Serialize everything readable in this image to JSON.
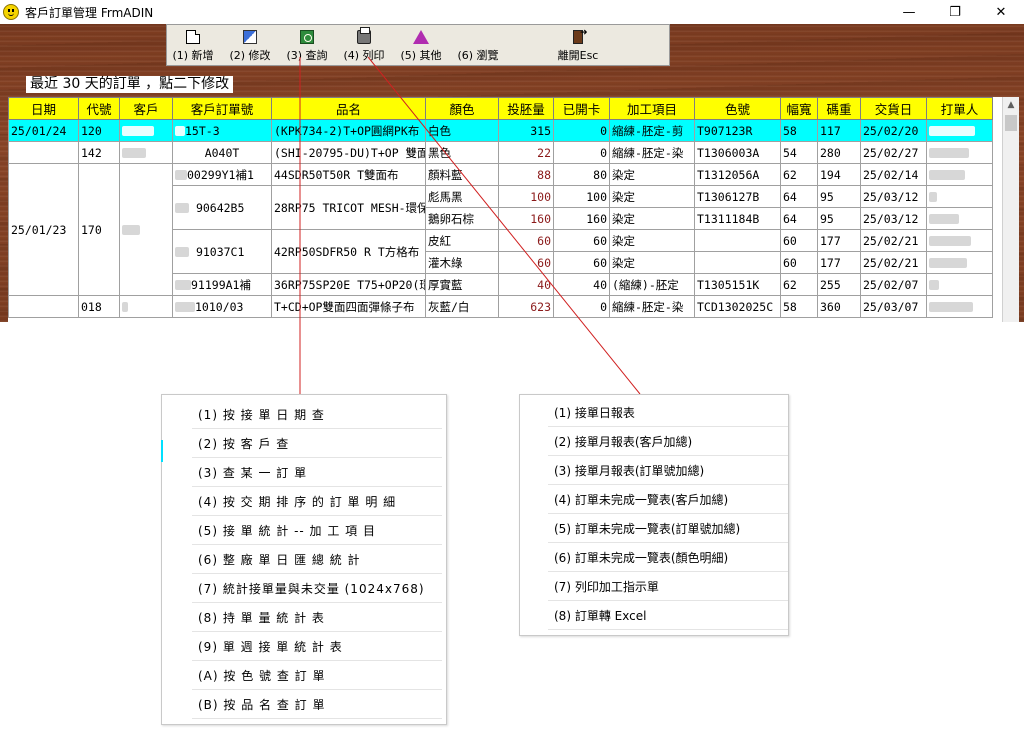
{
  "window": {
    "title": "客戶訂單管理 FrmADIN",
    "minimize_icon": "minimize-icon",
    "maximize_icon": "restore-icon",
    "close_icon": "close-icon"
  },
  "toolbar": {
    "buttons": [
      {
        "label": "(1) 新增",
        "icon": "new-document-icon"
      },
      {
        "label": "(2) 修改",
        "icon": "edit-icon"
      },
      {
        "label": "(3) 查詢",
        "icon": "search-icon"
      },
      {
        "label": "(4) 列印",
        "icon": "printer-icon"
      },
      {
        "label": "(5) 其他",
        "icon": "triangle-icon"
      },
      {
        "label": "(6) 瀏覽",
        "icon": ""
      },
      {
        "label": "離開Esc",
        "icon": "exit-door-icon"
      }
    ]
  },
  "hint": "最近 30 天的訂單 ，點二下修改",
  "grid": {
    "columns": [
      "日期",
      "代號",
      "客戶",
      "客戶訂單號",
      "品名",
      "顏色",
      "投胚量",
      "已開卡",
      "加工項目",
      "色號",
      "幅寬",
      "碼重",
      "交貨日",
      "打單人"
    ],
    "rows": [
      {
        "date": "25/01/24",
        "code": "120",
        "order_no": "15T-3",
        "product": "(KPK734-2)T+OP圓網PK布",
        "color": "白色",
        "input": "315",
        "opened": "0",
        "process": "縮練-胚定-剪",
        "color_no": "T907123R",
        "width": "58",
        "weight": "117",
        "delivery": "25/02/20"
      },
      {
        "date": "",
        "code": "142",
        "order_no": "A040T",
        "product": "(SHI-20795-DU)T+OP 雙面",
        "color": "黑色",
        "input": "22",
        "opened": "0",
        "process": "縮練-胚定-染",
        "color_no": "T1306003A",
        "width": "54",
        "weight": "280",
        "delivery": "25/02/27"
      },
      {
        "date": "25/01/23",
        "code": "170",
        "order_no": "00299Y1補1",
        "product": "44SDR50T50R T雙面布",
        "color": "顏料藍",
        "input": "88",
        "opened": "80",
        "process": "染定",
        "color_no": "T1312056A",
        "width": "62",
        "weight": "194",
        "delivery": "25/02/14"
      },
      {
        "date": "",
        "code": "",
        "order_no": "90642B5",
        "product": "28RP75 TRICOT MESH-環保",
        "color": "彪馬黑",
        "input": "100",
        "opened": "100",
        "process": "染定",
        "color_no": "T1306127B",
        "width": "64",
        "weight": "95",
        "delivery": "25/03/12"
      },
      {
        "date": "",
        "code": "",
        "order_no": "",
        "product": "",
        "color": "鵝卵石棕",
        "input": "160",
        "opened": "160",
        "process": "染定",
        "color_no": "T1311184B",
        "width": "64",
        "weight": "95",
        "delivery": "25/03/12"
      },
      {
        "date": "",
        "code": "",
        "order_no": "91037C1",
        "product": "42RP50SDFR50 R T方格布",
        "color": "皮紅",
        "input": "60",
        "opened": "60",
        "process": "染定",
        "color_no": "",
        "width": "60",
        "weight": "177",
        "delivery": "25/02/21"
      },
      {
        "date": "",
        "code": "",
        "order_no": "",
        "product": "",
        "color": "灌木綠",
        "input": "60",
        "opened": "60",
        "process": "染定",
        "color_no": "",
        "width": "60",
        "weight": "177",
        "delivery": "25/02/21"
      },
      {
        "date": "",
        "code": "",
        "order_no": "91199A1補",
        "product": "36RP75SP20E T75+OP20(環",
        "color": "厚實藍",
        "input": "40",
        "opened": "40",
        "process": "(縮練)-胚定",
        "color_no": "T1305151K",
        "width": "62",
        "weight": "255",
        "delivery": "25/02/07"
      },
      {
        "date": "",
        "code": "018",
        "order_no": "1010/03",
        "product": "T+CD+OP雙面四面彈條子布",
        "color": "灰藍/白",
        "input": "623",
        "opened": "0",
        "process": "縮練-胚定-染",
        "color_no": "TCD1302025C",
        "width": "58",
        "weight": "360",
        "delivery": "25/03/07"
      }
    ]
  },
  "menu_query": {
    "items": [
      "(1) 按 接 單 日 期 查",
      "(2) 按 客 戶 查",
      "(3) 查 某 一 訂 單",
      "(4) 按 交 期 排 序 的 訂 單 明 細",
      "(5) 接 單 統 計 -- 加 工 項 目",
      "(6) 整 廠 單 日 匯 總 統 計",
      "(7) 統計接單量與未交量 (1024x768)",
      "(8) 持 單 量 統 計 表",
      "(9) 單 週 接 單 統 計 表",
      "(A) 按 色 號 查 訂 單",
      "(B) 按 品 名 查 訂 單"
    ]
  },
  "menu_print": {
    "items": [
      "(1) 接單日報表",
      "(2) 接單月報表(客戶加總)",
      "(3) 接單月報表(訂單號加總)",
      "(4) 訂單未完成一覽表(客戶加總)",
      "(5) 訂單未完成一覽表(訂單號加總)",
      "(6) 訂單未完成一覽表(顏色明細)",
      "(7) 列印加工指示單",
      "(8) 訂單轉 Excel"
    ]
  },
  "colors": {
    "header_bg": "#ffff00",
    "selected_row_bg": "#00ffff",
    "numeric_text": "#8b1a1a",
    "callout_line": "#d02020",
    "wood": "#7a3a20"
  }
}
